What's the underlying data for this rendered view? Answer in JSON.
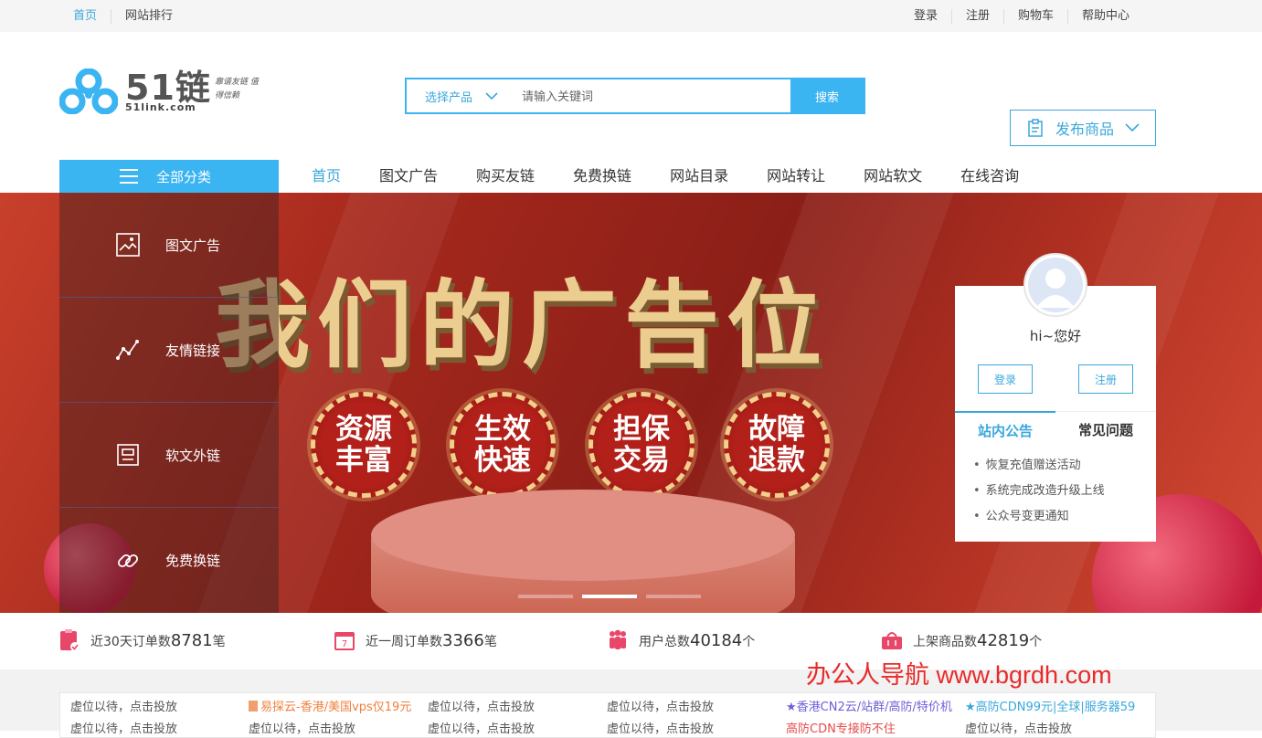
{
  "topbar": {
    "left": [
      "首页",
      "网站排行"
    ],
    "right": [
      "登录",
      "注册",
      "购物车",
      "帮助中心"
    ]
  },
  "logo": {
    "main": "51链",
    "sub": "51link.com",
    "slogan": "靠谱友链 值得信赖"
  },
  "search": {
    "select_label": "选择产品",
    "placeholder": "请输入关键词",
    "button": "搜索"
  },
  "publish": {
    "label": "发布商品"
  },
  "nav": {
    "all_categories": "全部分类",
    "items": [
      "首页",
      "图文广告",
      "购买友链",
      "免费换链",
      "网站目录",
      "网站转让",
      "网站软文",
      "在线咨询"
    ]
  },
  "categories": [
    "图文广告",
    "友情链接",
    "软文外链",
    "免费换链"
  ],
  "banner": {
    "headline": "我们的广告位",
    "badges": [
      "资源\n丰富",
      "生效\n快速",
      "担保\n交易",
      "故障\n退款"
    ],
    "active_slide": 2,
    "slide_count": 3
  },
  "usercard": {
    "greeting": "hi~您好",
    "login": "登录",
    "register": "注册",
    "tabs": [
      "站内公告",
      "常见问题"
    ],
    "notices": [
      "恢复充值赠送活动",
      "系统完成改造升级上线",
      "公众号变更通知"
    ]
  },
  "stats": [
    {
      "label": "近30天订单数",
      "value": "8781",
      "unit": "笔"
    },
    {
      "label": "近一周订单数",
      "value": "3366",
      "unit": "笔"
    },
    {
      "label": "用户总数",
      "value": "40184",
      "unit": "个"
    },
    {
      "label": "上架商品数",
      "value": "42819",
      "unit": "个"
    }
  ],
  "watermark": "办公人导航 www.bgrdh.com",
  "ads": {
    "row1": [
      "虚位以待，点击投放",
      "易探云-香港/美国vps仅19元",
      "虚位以待，点击投放",
      "虚位以待，点击投放",
      "★香港CN2云/站群/高防/特价机",
      "★高防CDN99元|全球|服务器59"
    ],
    "row2": [
      "虚位以待，点击投放",
      "虚位以待，点击投放",
      "虚位以待，点击投放",
      "虚位以待，点击投放",
      "高防CDN专接防不住",
      "虚位以待，点击投放"
    ]
  },
  "colors": {
    "accent": "#3bb4f2",
    "watermark": "#e82a2a"
  }
}
